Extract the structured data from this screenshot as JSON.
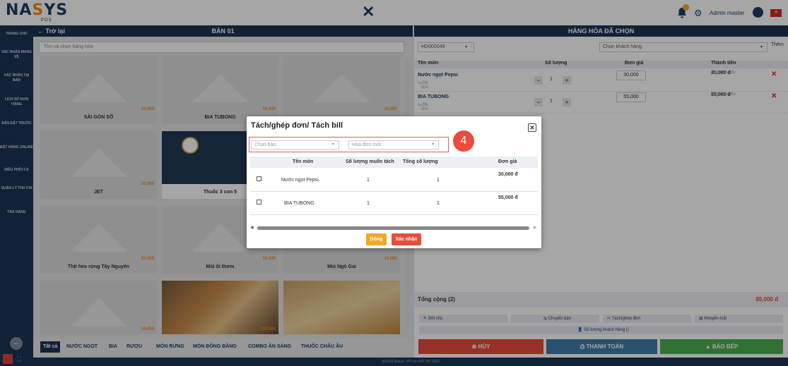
{
  "app": {
    "logo_main": "NASYS",
    "logo_sub": "POS",
    "user_name": "Admin master"
  },
  "colors": {
    "navy": "#1c3454",
    "orange": "#f28a1e",
    "red": "#e94b3c",
    "teal": "#3f7ca6",
    "green": "#4caf50"
  },
  "sidebar": {
    "items": [
      "TRANG CHỦ",
      "XÁC NHẬN MANG VỀ",
      "XÁC NHẬN TẠI BÀN",
      "LỊCH SỬ ĐƠN HÀNG",
      "BÀN ĐẶT TRƯỚC",
      "ĐẶT HÀNG ONLINE",
      "ĐIỀU PHỐI CA",
      "QUẢN LÝ THU CHI",
      "TRẢ HÀNG"
    ]
  },
  "left_panel": {
    "back": "← Trở lại",
    "table_name": "BÀN 01",
    "search_placeholder": "Tìm và chọn hàng hóa"
  },
  "products": [
    {
      "name": "SÀI GÒN SỐ",
      "price": "10,000"
    },
    {
      "name": "BIA TUBONG",
      "price": "55,000"
    },
    {
      "name": "",
      "price": "10,000"
    },
    {
      "name": "JET",
      "price": "10,000"
    },
    {
      "name": "Thuốc 3 con 5",
      "price": ""
    },
    {
      "name": "",
      "price": ""
    },
    {
      "name": "Thịt heo rừng Tây Nguyên",
      "price": "10,000"
    },
    {
      "name": "Mùi ổi thơm",
      "price": "10,000"
    },
    {
      "name": "Mùi Ngò Gai",
      "price": "10,000"
    },
    {
      "name": "",
      "price": "15,000"
    },
    {
      "name": "",
      "price": "150,000"
    },
    {
      "name": "",
      "price": "10,000"
    }
  ],
  "categories": [
    "Tất cả",
    "NƯỚC NGỌT",
    "BIA",
    "RƯỢU",
    "MÓN RỪNG",
    "MÓN ĐÔNG BĂNG",
    "COMBO ĂN SÁNG",
    "THUỐC CHÂU ÂU"
  ],
  "footer": "@2025 Nasys | Hỗ trợ 090 750 1000",
  "right_panel": {
    "title": "HÀNG HÓA ĐÃ CHỌN",
    "order_id": "HD000049",
    "customer_placeholder": "Chọn khách hàng",
    "add": "Thêm",
    "headers": [
      "Tên món",
      "Số lượng",
      "Đơn giá",
      "Thành tiền"
    ],
    "items": [
      {
        "name": "Nước ngọt Pepsi",
        "note": "Ghi chú",
        "qty": "1",
        "price": "30,000",
        "total": "30,000 đ",
        "status": "Chờ báo bếp"
      },
      {
        "name": "BIA TUBONG",
        "note": "Ghi chú",
        "qty": "1",
        "price": "55,000",
        "total": "55,000 đ",
        "status": "Chờ báo bếp"
      }
    ],
    "total_label": "Tổng cộng (2)",
    "total_value": "85,000 đ",
    "actions": [
      "Ghi chú",
      "Chuyển bàn",
      "Tách/ghép đơn",
      "Khuyến mãi"
    ],
    "guests": "Số lượng khách hàng ()",
    "cancel": "HỦY",
    "pay": "THANH TOÁN",
    "kitchen": "BÁO BẾP"
  },
  "modal": {
    "title": "Tách/ghép đơn/ Tách bill",
    "table_placeholder": "Chọn bàn",
    "bill_placeholder": "Hóa đơn mới",
    "badge": "4",
    "headers": [
      "Tên món",
      "Số lượng muốn tách",
      "Tổng số lượng",
      "Đơn giá"
    ],
    "rows": [
      {
        "name": "Nước ngọt Pepsi",
        "split": "1",
        "total": "1",
        "price": "30,000 đ"
      },
      {
        "name": "BIA TUBONG",
        "split": "1",
        "total": "1",
        "price": "55,000 đ"
      }
    ],
    "close": "Đóng",
    "confirm": "Xác nhận"
  }
}
